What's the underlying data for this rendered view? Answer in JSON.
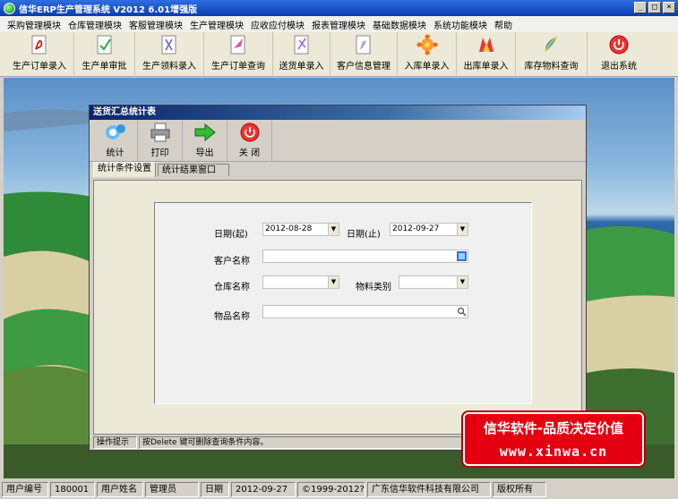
{
  "window": {
    "title": "信华ERP生产管理系统   V2012   6.01增强版",
    "controls": [
      "_",
      "□",
      "×"
    ]
  },
  "menu": [
    "采购管理模块",
    "仓库管理模块",
    "客服管理模块",
    "生产管理模块",
    "应收应付模块",
    "报表管理模块",
    "基础数据模块",
    "系统功能模块",
    "帮助"
  ],
  "toolbar": [
    {
      "label": "生产订单录入",
      "icon": "pdf-document-icon"
    },
    {
      "label": "生产单审批",
      "icon": "approve-document-icon"
    },
    {
      "label": "生产领料录入",
      "icon": "material-document-icon"
    },
    {
      "label": "生产订单查询",
      "icon": "query-document-icon"
    },
    {
      "label": "送货单录入",
      "icon": "delivery-document-icon"
    },
    {
      "label": "客户信息管理",
      "icon": "customer-document-icon"
    },
    {
      "label": "入库单录入",
      "icon": "stock-in-icon"
    },
    {
      "label": "出库单录入",
      "icon": "stock-out-icon"
    },
    {
      "label": "库存物料查询",
      "icon": "inventory-query-icon"
    },
    {
      "label": "退出系统",
      "icon": "power-icon"
    }
  ],
  "child": {
    "title": "送货汇总统计表",
    "toolbar": [
      {
        "label": "统计",
        "icon": "statistics-icon"
      },
      {
        "label": "打印",
        "icon": "printer-icon"
      },
      {
        "label": "导出",
        "icon": "export-arrow-icon"
      },
      {
        "label": "关 闭",
        "icon": "close-power-icon"
      }
    ],
    "tabs": [
      "统计条件设置",
      "统计结果窗口"
    ],
    "form": {
      "date_start_label": "日期(起)",
      "date_start_value": "2012-08-28",
      "date_end_label": "日期(止)",
      "date_end_value": "2012-09-27",
      "customer_label": "客户名称",
      "customer_value": "",
      "warehouse_label": "仓库名称",
      "warehouse_value": "",
      "material_type_label": "物料类别",
      "material_type_value": "",
      "item_label": "物品名称",
      "item_value": ""
    },
    "hint_label": "操作提示",
    "hint_text": "按Delete 键可删除查询条件内容。"
  },
  "brand": {
    "line1": "信华软件-品质决定价值",
    "line2": "www.xinwa.cn"
  },
  "status": {
    "user_id_label": "用户编号",
    "user_id": "180001",
    "user_name_label": "用户姓名",
    "user_name": "管理员",
    "date_label": "日期",
    "date": "2012-09-27",
    "copyright": "©1999-2012?",
    "company": "广东信华软件科技有限公司",
    "rights": "版权所有"
  }
}
